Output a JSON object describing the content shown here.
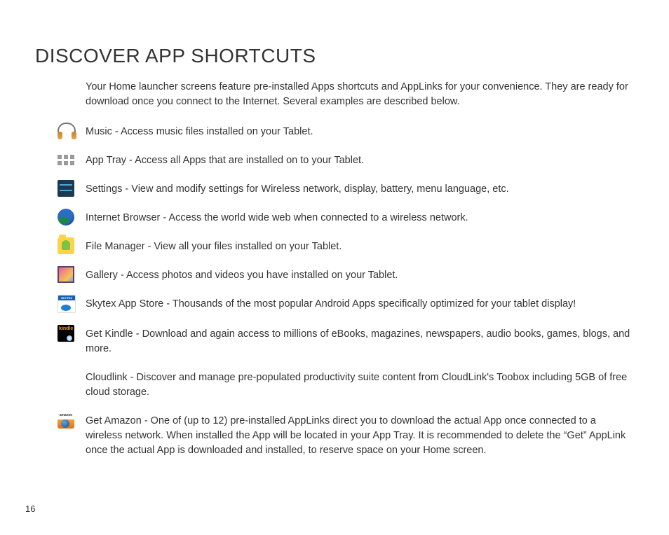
{
  "heading": "DISCOVER APP SHORTCUTS",
  "intro": "Your Home launcher screens feature pre-installed Apps shortcuts and AppLinks for your convenience. They are ready for download once you connect to the Internet. Several examples are described below.",
  "items": [
    {
      "icon": "music",
      "text": "Music - Access music files installed on your Tablet."
    },
    {
      "icon": "apptray",
      "text": "App Tray - Access all Apps that are installed on to your Tablet."
    },
    {
      "icon": "settings",
      "text": "Settings - View and modify settings for Wireless network, display, battery, menu language, etc."
    },
    {
      "icon": "browser",
      "text": "Internet Browser - Access the world wide web when connected to a wireless network."
    },
    {
      "icon": "filemgr",
      "text": "File Manager - View all your files installed on your Tablet."
    },
    {
      "icon": "gallery",
      "text": "Gallery - Access photos and videos you have installed on your Tablet."
    },
    {
      "icon": "skytex",
      "text": "Skytex App Store - Thousands of the most popular Android Apps specifically optimized for your tablet display!"
    },
    {
      "icon": "kindle",
      "text": "Get Kindle - Download and again access to millions of eBooks, magazines, newspapers, audio books, games, blogs, and more."
    },
    {
      "icon": "",
      "text": "Cloudlink - Discover and manage pre-populated productivity suite content from CloudLink's Toobox including 5GB of free cloud storage."
    },
    {
      "icon": "amazon",
      "text": "Get Amazon - One of (up to 12) pre-installed AppLinks direct you to download the actual App once connected to a wireless network. When installed the App will be located in your App Tray. It is recommended to delete the “Get” AppLink once the actual App is downloaded and installed, to reserve space on your Home screen."
    }
  ],
  "page_number": "16"
}
